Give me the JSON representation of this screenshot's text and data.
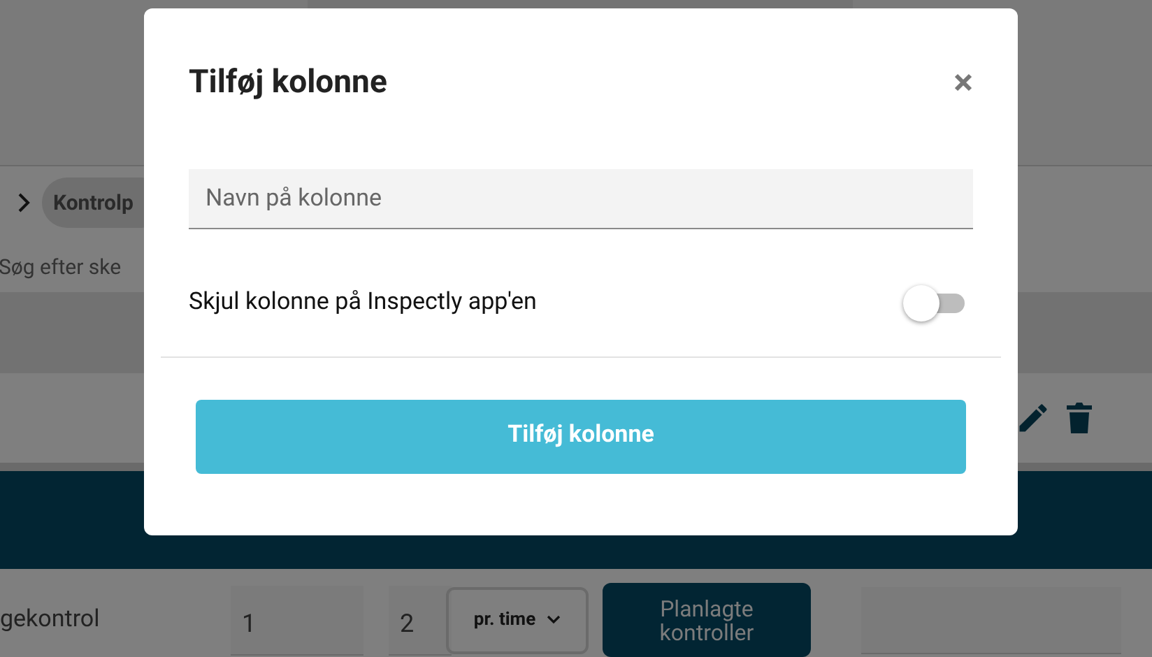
{
  "background": {
    "breadcrumb": {
      "label": "Kontrolp"
    },
    "search": {
      "placeholder": "Søg efter ske"
    },
    "row": {
      "name": "gekontrol",
      "interval": "1",
      "count": "2",
      "unit": "pr. time",
      "button": "Planlagte kontroller"
    }
  },
  "dialog": {
    "title": "Tilføj kolonne",
    "field": {
      "placeholder": "Navn på kolonne"
    },
    "toggle": {
      "label": "Skjul kolonne på Inspectly app'en",
      "on": false
    },
    "submit": "Tilføj kolonne"
  }
}
